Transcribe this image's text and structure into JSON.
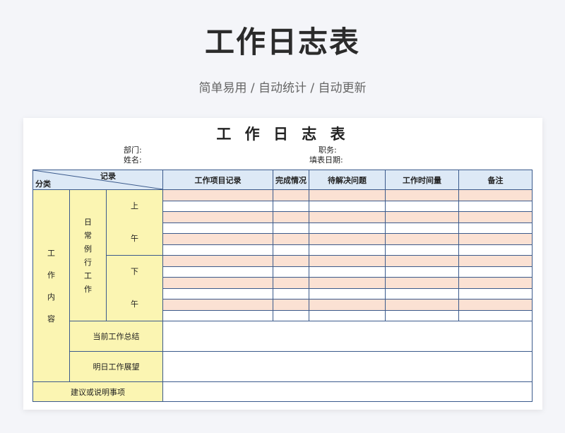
{
  "banner": {
    "title": "工作日志表",
    "subtitle": "简单易用 / 自动统计 / 自动更新"
  },
  "sheet": {
    "title": "工 作 日 志 表",
    "labels": {
      "department": "部门:",
      "name": "姓名:",
      "position": "职务:",
      "date": "填表日期:"
    }
  },
  "table": {
    "corner_top": "记录",
    "corner_bottom": "分类",
    "headers": [
      "工作项目记录",
      "完成情况",
      "待解决问题",
      "工作时间量",
      "备注"
    ],
    "section_label": "工作内容",
    "section_chars": [
      "工",
      "作",
      "内",
      "容"
    ],
    "routine_label": "日常例行工作",
    "routine_chars": [
      "日",
      "常",
      "例",
      "行",
      "工",
      "作"
    ],
    "morning": [
      "上",
      "午"
    ],
    "afternoon": [
      "下",
      "午"
    ],
    "current_summary": "当前工作总结",
    "tomorrow_outlook": "明日工作展望",
    "suggestions": "建议或说明事项"
  },
  "colors": {
    "header_bg": "#dde9f6",
    "category_bg": "#fbf5b2",
    "stripe_bg": "#fbe1d3",
    "border": "#3b5a8c"
  }
}
